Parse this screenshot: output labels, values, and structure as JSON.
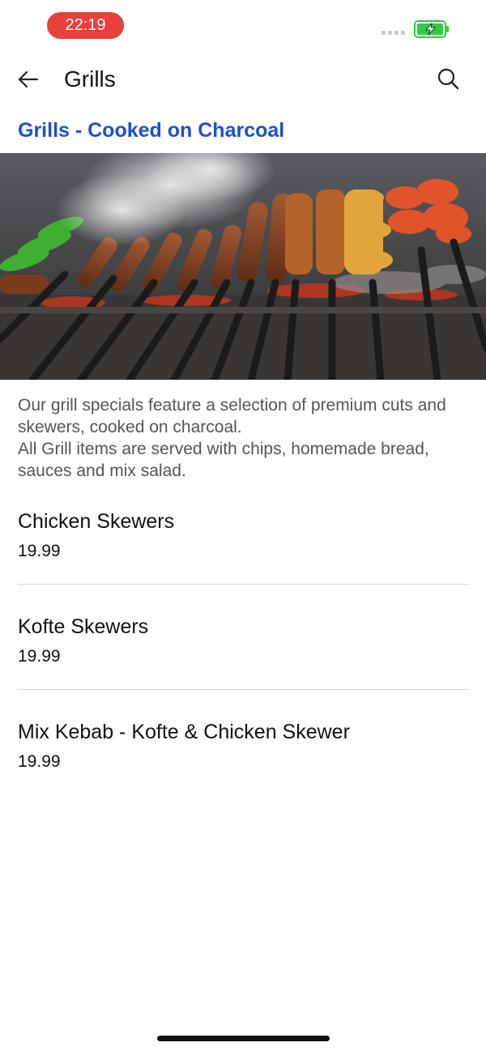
{
  "status_bar": {
    "time": "22:19",
    "signal_icon": "signal-dots-icon",
    "battery_icon": "battery-charging-icon",
    "battery_color": "#2ecc40"
  },
  "header": {
    "back_icon": "arrow-left-icon",
    "title": "Grills",
    "search_icon": "search-icon"
  },
  "section": {
    "title": "Grills - Cooked on Charcoal",
    "title_color": "#1f4fc9",
    "image_subject": "charcoal grill with meat and chicken skewers",
    "description_lines": [
      "Our grill specials feature a selection of premium cuts and skewers, cooked on charcoal.",
      "All Grill items are served with chips, homemade bread, sauces and mix salad."
    ]
  },
  "menu_items": [
    {
      "name": "Chicken Skewers",
      "price": "19.99"
    },
    {
      "name": "Kofte Skewers",
      "price": "19.99"
    },
    {
      "name": "Mix Kebab - Kofte & Chicken Skewer",
      "price": "19.99"
    }
  ],
  "colors": {
    "time_pill": "#e8403a",
    "divider": "#d6d6d6"
  }
}
